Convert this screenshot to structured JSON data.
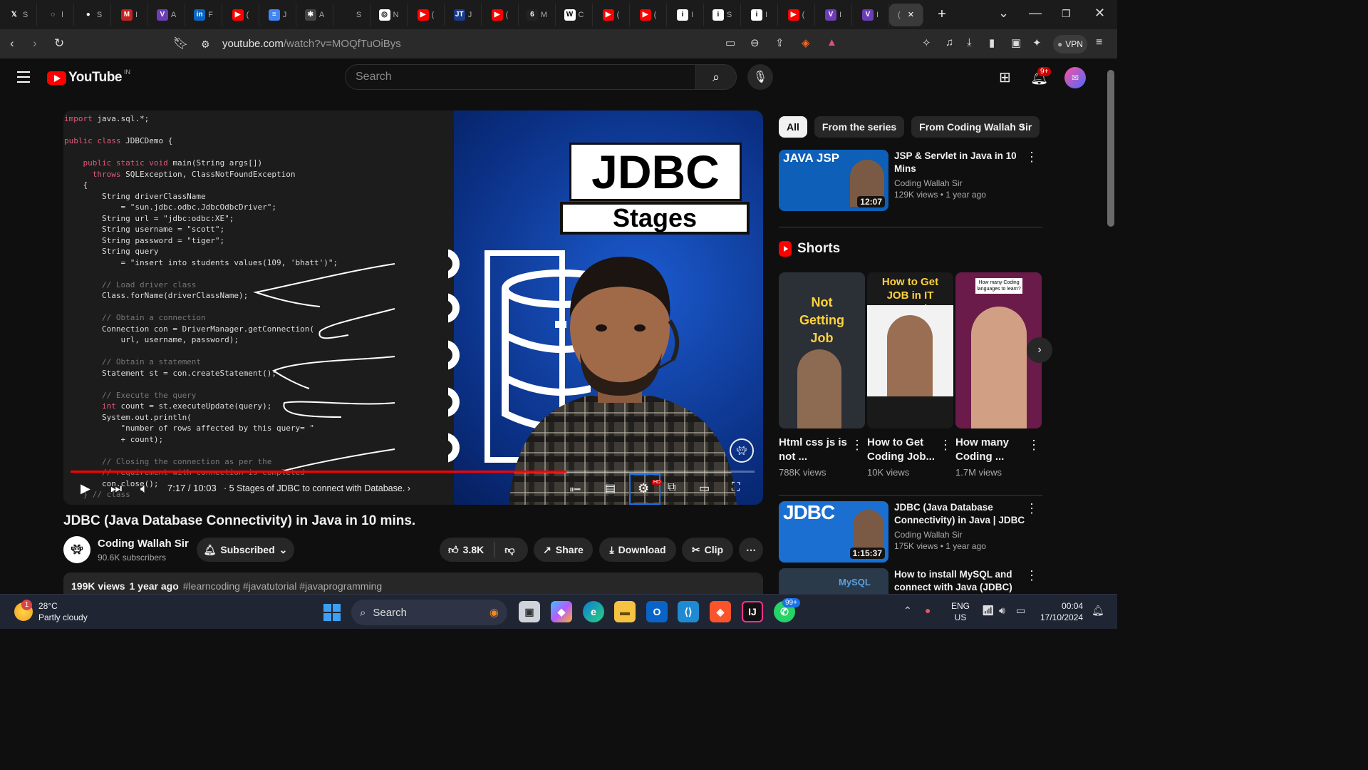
{
  "browser": {
    "tabs": [
      {
        "icon": "x-icon",
        "label": "S",
        "color": "#1b1b1b",
        "glyph": "𝕏"
      },
      {
        "icon": "loading-icon",
        "label": "l",
        "color": "#1b1b1b",
        "glyph": "◌"
      },
      {
        "icon": "github-icon",
        "label": "S",
        "color": "#1b1b1b",
        "glyph": "●"
      },
      {
        "icon": "gmail-icon",
        "label": "I",
        "color": "#c5221f",
        "glyph": "M"
      },
      {
        "icon": "vscode-tab-icon",
        "label": "A",
        "color": "#6a3fb5",
        "glyph": "V"
      },
      {
        "icon": "linkedin-icon",
        "label": "F",
        "color": "#0a66c2",
        "glyph": "in"
      },
      {
        "icon": "youtube-icon",
        "label": "(",
        "color": "#ff0000",
        "glyph": "▶"
      },
      {
        "icon": "docs-icon",
        "label": "J",
        "color": "#4285f4",
        "glyph": "≡"
      },
      {
        "icon": "site-icon",
        "label": "A",
        "color": "#444",
        "glyph": "✱"
      },
      {
        "icon": "blank-icon",
        "label": "S",
        "color": "#1b1b1b",
        "glyph": ""
      },
      {
        "icon": "chatgpt-icon",
        "label": "N",
        "color": "#fff",
        "glyph": "◎"
      },
      {
        "icon": "youtube-icon",
        "label": "(",
        "color": "#ff0000",
        "glyph": "▶"
      },
      {
        "icon": "jtc-icon",
        "label": "J",
        "color": "#1b3a8a",
        "glyph": "JT"
      },
      {
        "icon": "youtube-icon",
        "label": "(",
        "color": "#ff0000",
        "glyph": "▶"
      },
      {
        "icon": "site-icon",
        "label": "M",
        "color": "#222",
        "glyph": "6"
      },
      {
        "icon": "wix-icon",
        "label": "C",
        "color": "#fff",
        "glyph": "W"
      },
      {
        "icon": "youtube-icon",
        "label": "(",
        "color": "#ff0000",
        "glyph": "▶"
      },
      {
        "icon": "youtube-icon",
        "label": "(",
        "color": "#ff0000",
        "glyph": "▶"
      },
      {
        "icon": "info-icon",
        "label": "I",
        "color": "#fff",
        "glyph": "i"
      },
      {
        "icon": "info-icon",
        "label": "S",
        "color": "#fff",
        "glyph": "i"
      },
      {
        "icon": "info-icon",
        "label": "I",
        "color": "#fff",
        "glyph": "i"
      },
      {
        "icon": "youtube-icon",
        "label": "(",
        "color": "#ff0000",
        "glyph": "▶"
      },
      {
        "icon": "vscode-tab-icon",
        "label": "I",
        "color": "#6a3fb5",
        "glyph": "V"
      },
      {
        "icon": "vscode-tab-icon",
        "label": "I",
        "color": "#6a3fb5",
        "glyph": "V"
      },
      {
        "icon": "active-tab",
        "label": "(",
        "color": "#3a3a3a",
        "glyph": ""
      }
    ],
    "close_tab": "✕",
    "new_tab": "+",
    "url_host": "youtube.com",
    "url_path": "/watch?v=MOQfTuOiBys",
    "vpn_label": "VPN"
  },
  "youtube": {
    "logo_text": "YouTube",
    "country": "IN",
    "search_placeholder": "Search",
    "notif_badge": "9+"
  },
  "player": {
    "time": "7:17 / 10:03",
    "chapter": "5 Stages of JDBC to connect with Database.",
    "progress": 0.725,
    "hd_badge": "HD",
    "thumb_title": "JDBC",
    "thumb_subtitle": "Stages"
  },
  "code_lines": [
    {
      "t": "import java.sql.*;",
      "k": "import"
    },
    {
      "t": "",
      "k": ""
    },
    {
      "t": "public class JDBCDemo {",
      "k": "public class"
    },
    {
      "t": "",
      "k": ""
    },
    {
      "t": "    public static void main(String args[])",
      "k": "public static void"
    },
    {
      "t": "      throws SQLException, ClassNotFoundException",
      "k": "throws"
    },
    {
      "t": "    {",
      "k": ""
    },
    {
      "t": "        String driverClassName",
      "k": ""
    },
    {
      "t": "            = \"sun.jdbc.odbc.JdbcOdbcDriver\";",
      "k": ""
    },
    {
      "t": "        String url = \"jdbc:odbc:XE\";",
      "k": ""
    },
    {
      "t": "        String username = \"scott\";",
      "k": ""
    },
    {
      "t": "        String password = \"tiger\";",
      "k": ""
    },
    {
      "t": "        String query",
      "k": ""
    },
    {
      "t": "            = \"insert into students values(109, 'bhatt')\";",
      "k": ""
    },
    {
      "t": "",
      "k": ""
    },
    {
      "t": "        // Load driver class",
      "k": "cm"
    },
    {
      "t": "        Class.forName(driverClassName);",
      "k": ""
    },
    {
      "t": "",
      "k": ""
    },
    {
      "t": "        // Obtain a connection",
      "k": "cm"
    },
    {
      "t": "        Connection con = DriverManager.getConnection(",
      "k": ""
    },
    {
      "t": "            url, username, password);",
      "k": ""
    },
    {
      "t": "",
      "k": ""
    },
    {
      "t": "        // Obtain a statement",
      "k": "cm"
    },
    {
      "t": "        Statement st = con.createStatement();",
      "k": ""
    },
    {
      "t": "",
      "k": ""
    },
    {
      "t": "        // Execute the query",
      "k": "cm"
    },
    {
      "t": "        int count = st.executeUpdate(query);",
      "k": "int"
    },
    {
      "t": "        System.out.println(",
      "k": ""
    },
    {
      "t": "            \"number of rows affected by this query= \"",
      "k": ""
    },
    {
      "t": "            + count);",
      "k": ""
    },
    {
      "t": "",
      "k": ""
    },
    {
      "t": "        // Closing the connection as per the",
      "k": "cm"
    },
    {
      "t": "        // requirement with connection is completed",
      "k": "cm"
    },
    {
      "t": "        con.close();",
      "k": ""
    },
    {
      "t": "    } // class",
      "k": "cm"
    }
  ],
  "video": {
    "title": "JDBC (Java Database Connectivity) in Java in 10 mins.",
    "channel": "Coding Wallah Sir",
    "subscribers": "90.6K subscribers",
    "subscribed_label": "Subscribed",
    "likes": "3.8K",
    "share": "Share",
    "download": "Download",
    "clip": "Clip",
    "views": "199K views",
    "age": "1 year ago",
    "tags": "#learncoding #javatutorial #javaprogramming"
  },
  "chips": [
    "All",
    "From the series",
    "From Coding Wallah Sir"
  ],
  "recs": [
    {
      "title": "JSP & Servlet in Java in 10 Mins",
      "channel": "Coding Wallah Sir",
      "meta": "129K views • 1 year ago",
      "duration": "12:07",
      "thumb_text": "JAVA JSP",
      "bg": "#0d5fb8"
    },
    {
      "title": "JDBC (Java Database Connectivity) in Java | JDBC f...",
      "channel": "Coding Wallah Sir",
      "meta": "175K views • 1 year ago",
      "duration": "1:15:37",
      "thumb_text": "JDBC",
      "bg": "#1a6fd1"
    },
    {
      "title": "How to install MySQL and connect with Java (JDBC) in...",
      "channel": "",
      "meta": "",
      "duration": "",
      "thumb_text": "MySQL",
      "bg": "#2a3a4a"
    }
  ],
  "shorts_title": "Shorts",
  "shorts": [
    {
      "title": "Html css js is not ...",
      "views": "788K views",
      "overlay": "Not Getting Job",
      "bg": "#2b2f36"
    },
    {
      "title": "How to Get Coding Job...",
      "views": "10K views",
      "overlay": "How to Get JOB in IT Companies",
      "bg": "#1a1a1a"
    },
    {
      "title": "How many Coding ...",
      "views": "1.7M views",
      "overlay": "How many Coding languages to learn?",
      "bg": "#6b1b4a"
    }
  ],
  "taskbar": {
    "temp": "28°C",
    "weather": "Partly cloudy",
    "weather_badge": "1",
    "search": "Search",
    "whatsapp_badge": "99+",
    "lang1": "ENG",
    "lang2": "US",
    "time": "00:04",
    "date": "17/10/2024"
  }
}
